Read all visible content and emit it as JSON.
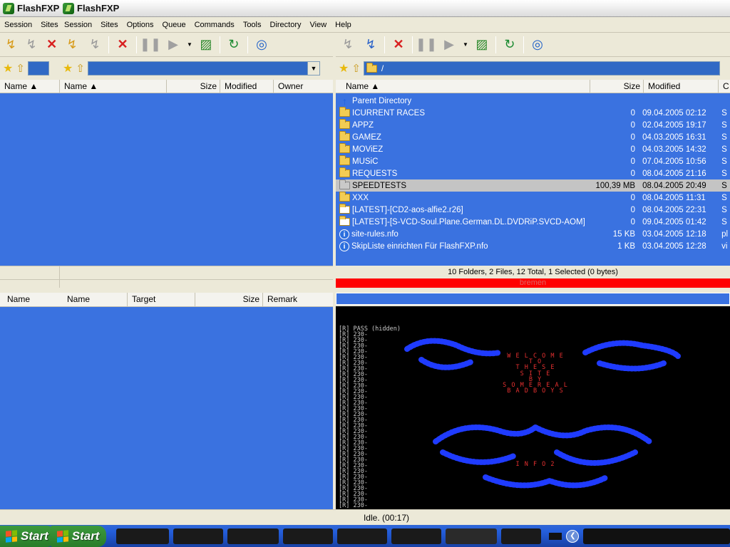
{
  "app": {
    "title_back": "FlashFXP",
    "title_front": "FlashFXP"
  },
  "menu_back": [
    "Session",
    "Sites"
  ],
  "menu_front": [
    "Session",
    "Sites",
    "Options",
    "Queue",
    "Commands",
    "Tools",
    "Directory",
    "View",
    "Help"
  ],
  "left_pane": {
    "col_name": "Name",
    "col_size": "Size",
    "col_modified": "Modified",
    "col_owner": "Owner",
    "path": ""
  },
  "back_pane": {
    "col_name": "Name"
  },
  "right_pane": {
    "path": "/",
    "col_name": "Name",
    "col_size": "Size",
    "col_modified": "Modified",
    "col_owner": "C",
    "files": [
      {
        "name": "Parent Directory",
        "size": "",
        "modified": "",
        "owner": "",
        "icon": "up-arrow-icon"
      },
      {
        "name": "ICURRENT RACES",
        "size": "0",
        "modified": "09.04.2005 02:12",
        "owner": "S",
        "icon": "folder-icon"
      },
      {
        "name": "APPZ",
        "size": "0",
        "modified": "02.04.2005 19:17",
        "owner": "S",
        "icon": "folder-icon"
      },
      {
        "name": "GAMEZ",
        "size": "0",
        "modified": "04.03.2005 16:31",
        "owner": "S",
        "icon": "folder-icon"
      },
      {
        "name": "MOViEZ",
        "size": "0",
        "modified": "04.03.2005 14:32",
        "owner": "S",
        "icon": "folder-icon"
      },
      {
        "name": "MUSiC",
        "size": "0",
        "modified": "07.04.2005 10:56",
        "owner": "S",
        "icon": "folder-icon"
      },
      {
        "name": "REQUESTS",
        "size": "0",
        "modified": "08.04.2005 21:16",
        "owner": "S",
        "icon": "folder-icon"
      },
      {
        "name": "SPEEDTESTS",
        "size": "100,39 MB",
        "modified": "08.04.2005 20:49",
        "owner": "S",
        "icon": "folder-icon",
        "selected": true
      },
      {
        "name": "XXX",
        "size": "0",
        "modified": "08.04.2005 11:31",
        "owner": "S",
        "icon": "folder-icon"
      },
      {
        "name": "[LATEST]-[CD2-aos-alfie2.r26]",
        "size": "0",
        "modified": "08.04.2005 22:31",
        "owner": "S",
        "icon": "link-folder-icon"
      },
      {
        "name": "[LATEST]-[S-VCD-Soul.Plane.German.DL.DVDRiP.SVCD-AOM]",
        "size": "0",
        "modified": "09.04.2005 01:42",
        "owner": "S",
        "icon": "link-folder-icon"
      },
      {
        "name": "site-rules.nfo",
        "size": "15 KB",
        "modified": "03.04.2005 12:18",
        "owner": "pl",
        "icon": "info-icon"
      },
      {
        "name": "SkipListe einrichten Für FlashFXP.nfo",
        "size": "1 KB",
        "modified": "03.04.2005 12:28",
        "owner": "vi",
        "icon": "info-icon"
      }
    ],
    "summary": "10 Folders, 2 Files, 12 Total, 1 Selected (0 bytes)",
    "site_name": "bremen"
  },
  "queue": {
    "col_name_back": "Name",
    "col_name": "Name",
    "col_target": "Target",
    "col_size": "Size",
    "col_remark": "Remark"
  },
  "log": {
    "first_line": "[R] PASS (hidden)",
    "repeat_line": "[R] 230-",
    "repeat_count": 31,
    "banner_lines": [
      "W E L C O M E",
      "T O",
      "T H E S E",
      "S I T E",
      "B Y",
      "S O M E   R E A L",
      "B A D B O Y S",
      "I N F O 2"
    ],
    "banner_color": "#e53030",
    "art_color": "#1f3bff"
  },
  "status": {
    "text": "Idle. (00:17)"
  },
  "taskbar": {
    "start_label": "Start",
    "start_label_2": "Start"
  }
}
